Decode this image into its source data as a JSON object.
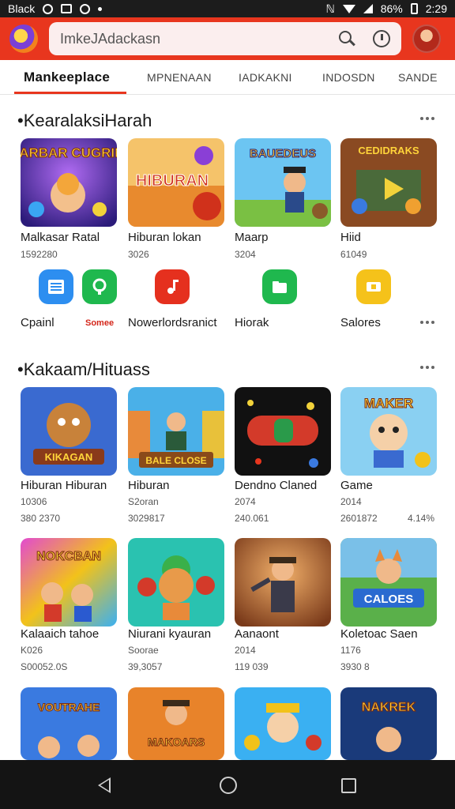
{
  "status_bar": {
    "carrier": "Black",
    "battery_text": "86%",
    "time": "2:29"
  },
  "search": {
    "placeholder": "ImkeJAdackasn"
  },
  "tabs": [
    {
      "label": "Mankeeplace",
      "active": true
    },
    {
      "label": "MPNENAAN",
      "active": false
    },
    {
      "label": "IADKAKNI",
      "active": false
    },
    {
      "label": "INDOSDN",
      "active": false
    },
    {
      "label": "SANDE",
      "active": false
    }
  ],
  "section1": {
    "title": "•KearalaksiHarah",
    "apps": [
      {
        "name": "Malkasar Ratal",
        "sub": "1592280",
        "art_text": "KARBAR CUGRINI"
      },
      {
        "name": "Hiburan lokan",
        "sub": "3026",
        "art_text": "HIBURAN"
      },
      {
        "name": "Maarp",
        "sub": "3204",
        "art_text": "BAUEDEUS"
      },
      {
        "name": "Hiid",
        "sub": "61049",
        "art_text": "CEDIDRAKS"
      }
    ],
    "small_apps": [
      {
        "name": "Cpainl",
        "badge": "Somee"
      },
      {
        "name": "Nowerlordsranict"
      },
      {
        "name": "Hiorak"
      },
      {
        "name": "Salores"
      }
    ]
  },
  "section2": {
    "title": "•Kakaam/Hituass",
    "row1": [
      {
        "name": "Hiburan Hiburan",
        "sub": "10306",
        "sub2": "380 2370",
        "art_text": "KIKAGAN"
      },
      {
        "name": "Hiburan",
        "sub": "S2oran",
        "sub2": "3029817",
        "art_text": "BALE CLOSE"
      },
      {
        "name": "Dendno Claned",
        "sub": "2074",
        "sub2": "240.061",
        "art_text": ""
      },
      {
        "name": "Game",
        "sub": "2014",
        "sub2": "2601872",
        "extra": "4.14%",
        "art_text": "MAKER"
      }
    ],
    "row2": [
      {
        "name": "Kalaaich tahoe",
        "sub": "K026",
        "sub2": "S00052.0S",
        "art_text": "NOKCBAN"
      },
      {
        "name": "Niurani kyauran",
        "sub": "Soorae",
        "sub2": "39,3057",
        "art_text": ""
      },
      {
        "name": "Aanaont",
        "sub": "2014",
        "sub2": "119 039",
        "art_text": ""
      },
      {
        "name": "Koletoac Saen",
        "sub": "1176",
        "sub2": "3930 8",
        "art_text": "CALOES"
      }
    ],
    "row3": [
      {
        "art_text": "VOUTRAHE"
      },
      {
        "art_text": "MAKOARS"
      },
      {
        "art_text": ""
      },
      {
        "art_text": "NAKREK"
      }
    ]
  }
}
